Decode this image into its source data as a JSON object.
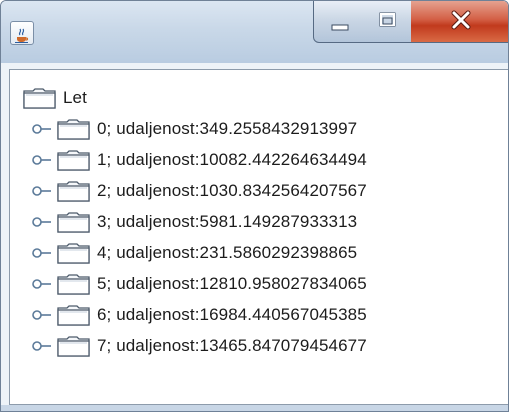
{
  "window": {
    "title": "",
    "icon": "java-cup-icon",
    "controls": [
      "minimize-icon",
      "maximize-icon",
      "close-icon"
    ]
  },
  "tree": {
    "root": {
      "label": "Let",
      "icon": "folder-icon"
    },
    "children": [
      {
        "label": "0; udaljenost:349.2558432913997",
        "icon": "folder-icon",
        "expander": "collapsed-handle-icon"
      },
      {
        "label": "1; udaljenost:10082.442264634494",
        "icon": "folder-icon",
        "expander": "collapsed-handle-icon"
      },
      {
        "label": "2; udaljenost:1030.8342564207567",
        "icon": "folder-icon",
        "expander": "collapsed-handle-icon"
      },
      {
        "label": "3; udaljenost:5981.149287933313",
        "icon": "folder-icon",
        "expander": "collapsed-handle-icon"
      },
      {
        "label": "4; udaljenost:231.5860292398865",
        "icon": "folder-icon",
        "expander": "collapsed-handle-icon"
      },
      {
        "label": "5; udaljenost:12810.958027834065",
        "icon": "folder-icon",
        "expander": "collapsed-handle-icon"
      },
      {
        "label": "6; udaljenost:16984.440567045385",
        "icon": "folder-icon",
        "expander": "collapsed-handle-icon"
      },
      {
        "label": "7; udaljenost:13465.847079454677",
        "icon": "folder-icon",
        "expander": "collapsed-handle-icon"
      }
    ]
  },
  "colors": {
    "titlebar": "#c9d8e8",
    "close_button": "#c13a1d",
    "tree_background": "#ffffff",
    "text": "#1c1c1c"
  }
}
